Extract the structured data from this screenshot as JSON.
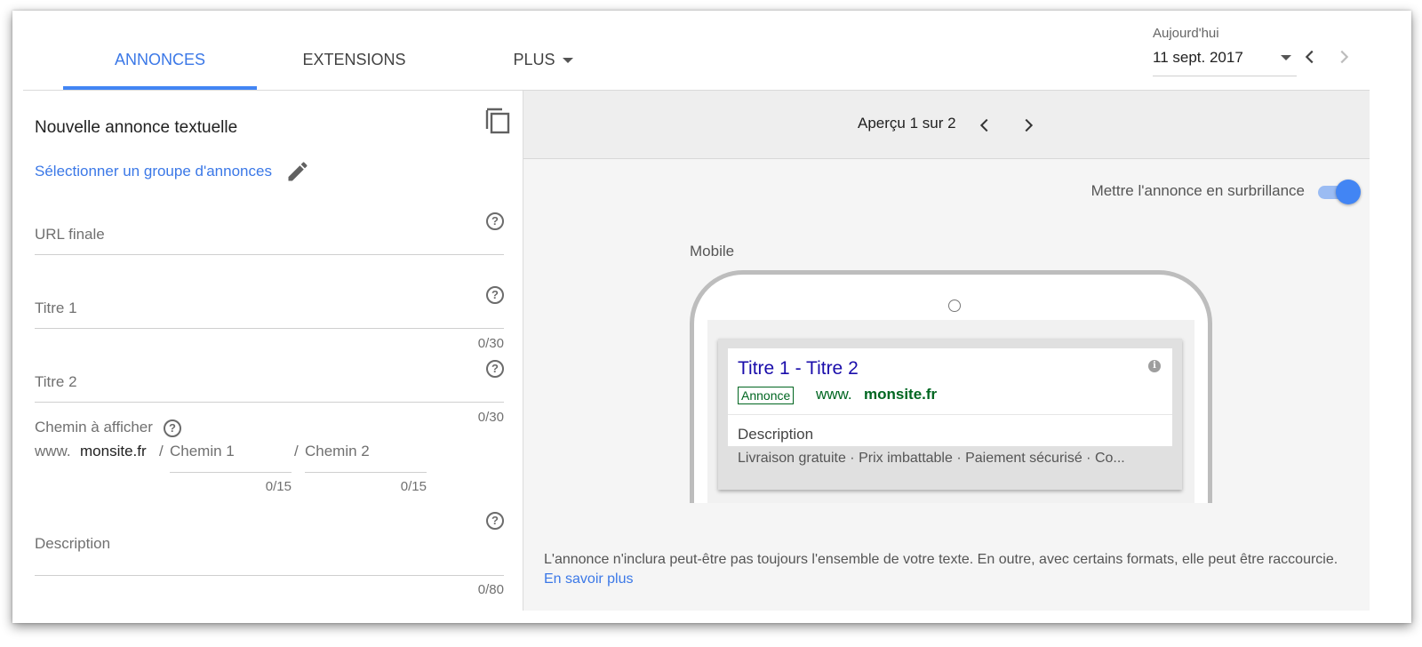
{
  "tabs": [
    {
      "label": "ANNONCES",
      "active": true
    },
    {
      "label": "EXTENSIONS",
      "active": false
    },
    {
      "label": "PLUS",
      "active": false
    }
  ],
  "date": {
    "label": "Aujourd'hui",
    "value": "11 sept. 2017"
  },
  "form": {
    "title": "Nouvelle annonce textuelle",
    "group_link": "Sélectionner un groupe d'annonces",
    "final_url": {
      "placeholder": "URL finale"
    },
    "title1": {
      "placeholder": "Titre 1",
      "counter": "0/30"
    },
    "title2": {
      "placeholder": "Titre 2",
      "counter": "0/30"
    },
    "display_path": {
      "label": "Chemin à afficher",
      "prefix": "www.",
      "domain": "monsite.fr",
      "slash": "/",
      "path1": {
        "placeholder": "Chemin 1",
        "counter": "0/15"
      },
      "path2": {
        "placeholder": "Chemin 2",
        "counter": "0/15"
      }
    },
    "description": {
      "placeholder": "Description",
      "counter": "0/80"
    }
  },
  "preview": {
    "count": "Aperçu 1 sur 2",
    "highlight_label": "Mettre l'annonce en surbrillance",
    "highlight_on": true,
    "device_label": "Mobile",
    "ad": {
      "title": "Titre 1 - Titre 2",
      "badge": "Annonce",
      "url_prefix": "www.",
      "url_domain": "monsite.fr",
      "description": "Description",
      "extensions": "Livraison gratuite · Prix imbattable · Paiement sécurisé · Co..."
    },
    "disclaimer": "L'annonce n'inclura peut-être pas toujours l'ensemble de votre texte. En outre, avec certains formats, elle peut être raccourcie.",
    "learn_more": "En savoir plus"
  },
  "colors": {
    "accent": "#4285f4",
    "link": "#3b78e7",
    "ad_title": "#1a0dab",
    "ad_url": "#006621"
  }
}
